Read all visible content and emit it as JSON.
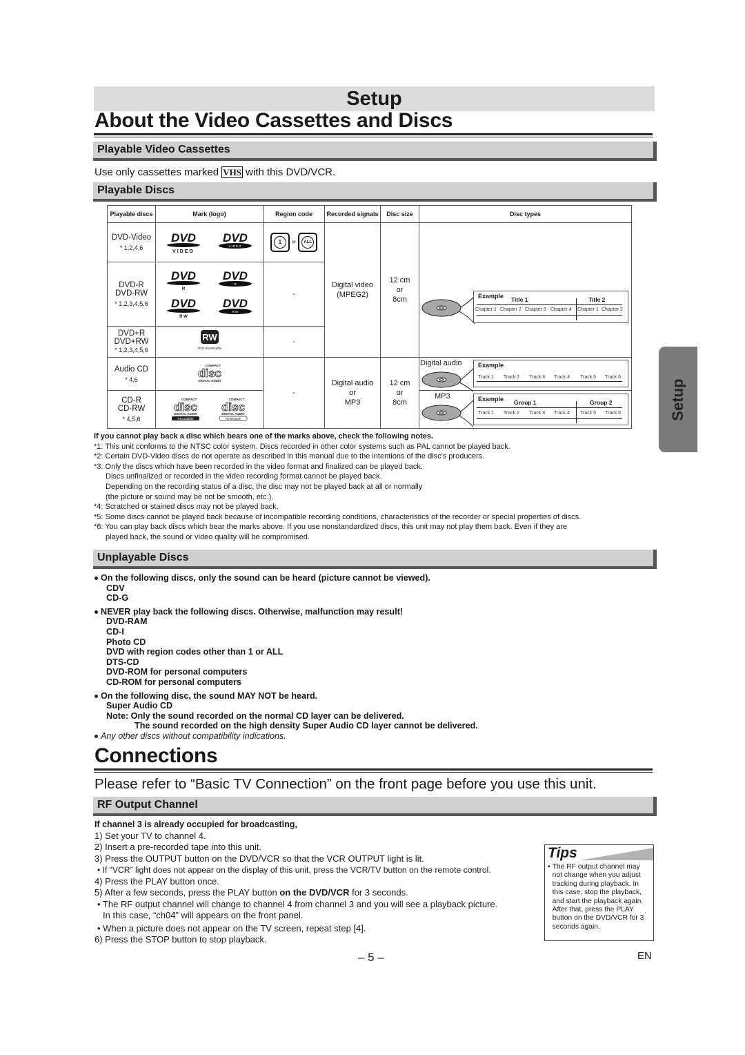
{
  "header": {
    "band_title": "Setup",
    "page_title": "About the Video Cassettes and Discs"
  },
  "cassettes": {
    "heading": "Playable Video Cassettes",
    "text_before": "Use only cassettes marked",
    "logo": "VHS",
    "text_after": "with this DVD/VCR."
  },
  "discs": {
    "heading": "Playable Discs",
    "columns": [
      "Playable discs",
      "Mark (logo)",
      "Region code",
      "Recorded signals",
      "Disc size",
      "Disc types"
    ],
    "rows": [
      {
        "name": "DVD-Video",
        "notes": "* 1,2,4,6",
        "logos": [
          "DVD VIDEO",
          "DVD VIDEO"
        ],
        "region": "1 or ALL"
      },
      {
        "name": "DVD-R\nDVD-RW",
        "notes": "* 1,2,3,4,5,6",
        "logos": [
          "DVD R",
          "DVD R",
          "DVD RW",
          "DVD RW"
        ],
        "region": "-"
      },
      {
        "name": "DVD+R\nDVD+RW",
        "notes": "* 1,2,3,4,5,6",
        "logos": [
          "RW DVD+ReWritable"
        ],
        "region": "-"
      },
      {
        "name": "Audio CD",
        "notes": "* 4,6",
        "logos": [
          "COMPACT DISC DIGITAL AUDIO"
        ],
        "region": "-"
      },
      {
        "name": "CD-R\nCD-RW",
        "notes": "* 4,5,6",
        "logos": [
          "COMPACT DISC DIGITAL AUDIO Recordable",
          "COMPACT DISC DIGITAL AUDIO ReWritable"
        ],
        "region": "-"
      }
    ],
    "region_or": "or",
    "region_icons": [
      "1",
      "ALL"
    ],
    "dash": "-",
    "video_signal": "Digital video\n(MPEG2)",
    "audio_signal": "Digital audio\nor\nMP3",
    "disc_size": "12 cm\nor\n8cm",
    "dvd_example": {
      "label": "Example",
      "titles": [
        "Title 1",
        "Title 2"
      ],
      "chapters": [
        "Chapter 1",
        "Chapter 2",
        "Chapter 3",
        "Chapter 4",
        "Chapter 1",
        "Chapter 2"
      ]
    },
    "cd_example": {
      "disc_label": "Digital audio",
      "label": "Example",
      "tracks": [
        "Track 1",
        "Track 2",
        "Track 3",
        "Track 4",
        "Track 5",
        "Track 6"
      ]
    },
    "mp3_example": {
      "disc_label": "MP3",
      "label": "Example",
      "groups": [
        "Group 1",
        "Group 2"
      ],
      "tracks": [
        "Track 1",
        "Track 2",
        "Track 3",
        "Track 4",
        "Track 5",
        "Track 6"
      ]
    }
  },
  "notes": {
    "intro": "If you cannot play back a disc which bears one of the marks above, check the following notes.",
    "lines": [
      "*1: This unit conforms to the NTSC color system. Discs recorded in other color systems such as PAL cannot be played back.",
      "*2: Certain DVD-Video discs do not operate as described in this manual due to the intentions of the disc's producers.",
      "*3: Only the discs which have been recorded in the video format and finalized can be played back.",
      "Discs unfinalized or recorded in the video recording format cannot be played back.",
      "Depending on the recording status of a disc, the disc may not be played back at all or normally",
      "(the picture or sound may be not be smooth, etc.).",
      "*4: Scratched or stained discs may not be played back.",
      "*5: Some discs cannot be played back because of incompatible recording conditions, characteristics of the recorder or special properties of discs.",
      "*6: You can play back discs which bear the marks above. If you use nonstandardized discs, this unit may not play them back. Even if they are",
      "played back, the sound or video quality will be compromised."
    ]
  },
  "unplayable": {
    "heading": "Unplayable Discs",
    "groups": [
      {
        "lead": "On the following discs, only the sound can be heard (picture cannot be viewed).",
        "items": [
          "CDV",
          "CD-G"
        ]
      },
      {
        "lead": "NEVER play back the following discs. Otherwise, malfunction may result!",
        "items": [
          "DVD-RAM",
          "CD-I",
          "Photo CD",
          "DVD with region codes other than 1 or ALL",
          "DTS-CD",
          "DVD-ROM for personal computers",
          "CD-ROM for personal computers"
        ]
      },
      {
        "lead": "On the following disc, the sound MAY NOT be heard.",
        "items": [
          "Super Audio CD",
          "Note: Only the sound recorded on the normal CD layer can be delivered."
        ],
        "sub": "The sound recorded on the high density Super Audio CD layer cannot be delivered."
      }
    ],
    "last": "Any other discs without compatibility indications."
  },
  "connections": {
    "title": "Connections",
    "intro": "Please refer to “Basic TV Connection” on the front page before you use this unit.",
    "heading": "RF Output Channel",
    "lead": "If channel 3 is already occupied for broadcasting,",
    "steps": [
      "1) Set your TV to channel 4.",
      "2) Insert a pre-recorded tape into this unit.",
      "3) Press the OUTPUT button on the DVD/VCR so that the VCR OUTPUT light is lit.",
      "• If “VCR” light does not appear on the display of this unit, press the VCR/TV button on the remote control.",
      "4) Press the PLAY button once."
    ],
    "step5_a": "5) After a few seconds, press the PLAY button ",
    "step5_b": "on the DVD/VCR",
    "step5_c": " for 3 seconds.",
    "steps_after": [
      "• The RF output channel will change to channel 4 from channel 3 and you will see a playback picture.",
      "In this case, “ch04” will appears on the front panel.",
      "• When a picture does not appear on the TV screen, repeat step [4].",
      "6) Press the STOP button to stop playback."
    ]
  },
  "tips": {
    "title": "Tips",
    "text": "The RF output channel may not change when you adjust tracking during playback. In this case, stop the playback, and start the playback again. After that, press the PLAY button on the DVD/VCR for 3 seconds again."
  },
  "side_tab": "Setup",
  "footer": {
    "page_number": "– 5 –",
    "lang": "EN"
  }
}
